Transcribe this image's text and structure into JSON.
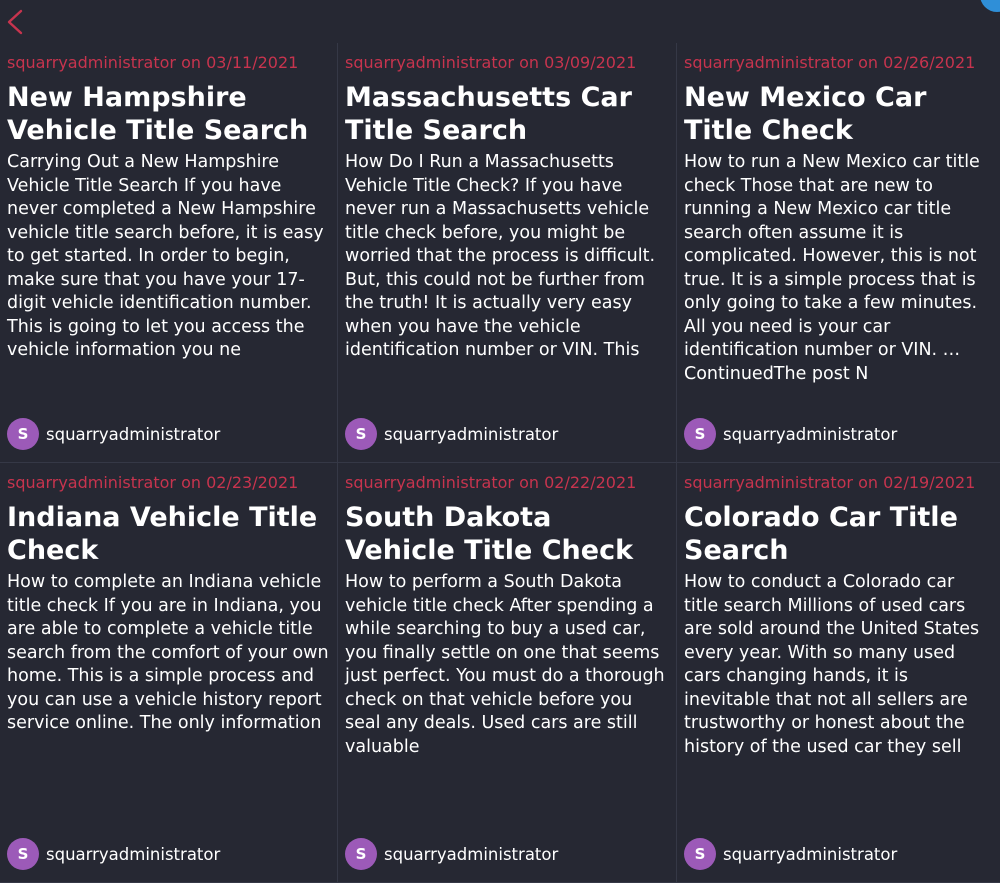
{
  "colors": {
    "background": "#262833",
    "accent": "#c7344e",
    "avatar": "#9c5ab8",
    "text": "#ffffff"
  },
  "header": {
    "back_icon": "chevron-left-icon"
  },
  "posts": [
    {
      "meta": "squarryadministrator on 03/11/2021",
      "title": "New Hampshire Vehicle Title Search",
      "excerpt": "Carrying Out a New Hampshire Vehicle Title Search If you have never completed a New Hampshire vehicle title search before, it is easy to get started. In order to begin, make sure that you have your 17-digit vehicle identification number. This is going to let you access the vehicle information you ne",
      "avatar_letter": "S",
      "author": "squarryadministrator"
    },
    {
      "meta": "squarryadministrator on 03/09/2021",
      "title": "Massachusetts Car Title Search",
      "excerpt": "How Do I Run a Massachusetts Vehicle Title Check? If you have never run a Massachusetts vehicle title check before, you might be worried that the process is difficult. But, this could not be further from the truth! It is actually very easy when you have the vehicle identification number or VIN. This",
      "avatar_letter": "S",
      "author": "squarryadministrator"
    },
    {
      "meta": "squarryadministrator on 02/26/2021",
      "title": "New Mexico Car Title Check",
      "excerpt": "How to run a New Mexico car title check Those that are new to running a New Mexico car title search often assume it is complicated. However, this is not true. It is a simple process that is only going to take a few minutes. All you need is your car identification number or VIN. … ContinuedThe post N",
      "avatar_letter": "S",
      "author": "squarryadministrator"
    },
    {
      "meta": "squarryadministrator on 02/23/2021",
      "title": "Indiana Vehicle Title Check",
      "excerpt": "How to complete an Indiana vehicle title check If you are in Indiana, you are able to complete a vehicle title search from the comfort of your own home. This is a simple process and you can use a vehicle history report service online. The only information",
      "avatar_letter": "S",
      "author": "squarryadministrator"
    },
    {
      "meta": "squarryadministrator on 02/22/2021",
      "title": "South Dakota Vehicle Title Check",
      "excerpt": "How to perform a South Dakota vehicle title check After spending a while searching to buy a used car, you finally settle on one that seems just perfect. You must do a thorough check on that vehicle before you seal any deals. Used cars are still valuable",
      "avatar_letter": "S",
      "author": "squarryadministrator"
    },
    {
      "meta": "squarryadministrator on 02/19/2021",
      "title": "Colorado Car Title Search",
      "excerpt": "How to conduct a Colorado car title search Millions of used cars are sold around the United States every year. With so many used cars changing hands, it is inevitable that not all sellers are trustworthy or honest about the history of the used car they sell",
      "avatar_letter": "S",
      "author": "squarryadministrator"
    }
  ]
}
